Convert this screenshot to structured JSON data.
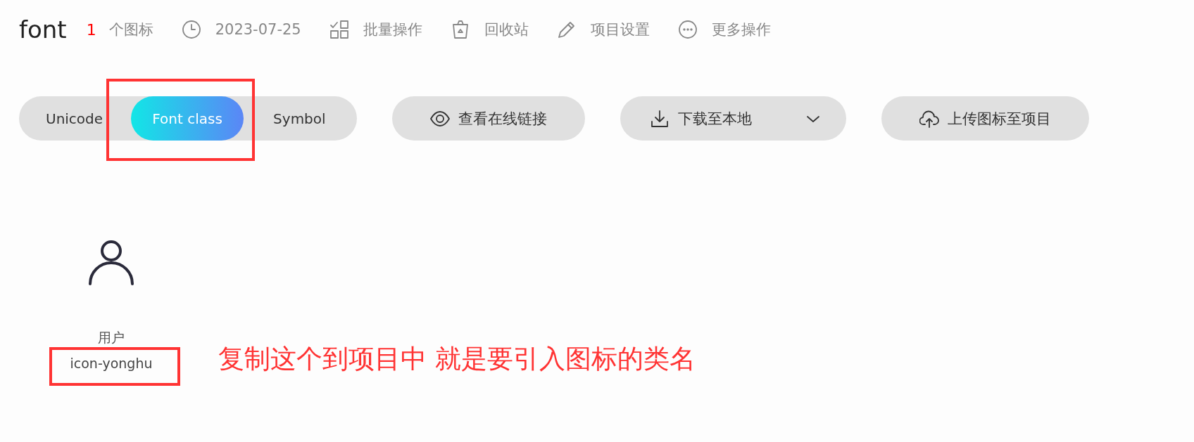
{
  "project": {
    "name": "font",
    "count": "1",
    "count_label": "个图标",
    "date": "2023-07-25"
  },
  "actions": [
    "批量操作",
    "回收站",
    "项目设置",
    "更多操作"
  ],
  "formats": [
    {
      "label": "Unicode",
      "selected": false
    },
    {
      "label": "Font class",
      "selected": true
    },
    {
      "label": "Symbol",
      "selected": false
    }
  ],
  "buttons": [
    {
      "label": "查看在线链接",
      "dropdown": false
    },
    {
      "label": "下载至本地",
      "dropdown": true
    },
    {
      "label": "上传图标至项目",
      "dropdown": false
    }
  ],
  "icons": [
    {
      "name": "用户",
      "class_name": "icon-yonghu"
    }
  ],
  "annotation": {
    "note": "复制这个到项目中 就是要引入图标的类名"
  }
}
